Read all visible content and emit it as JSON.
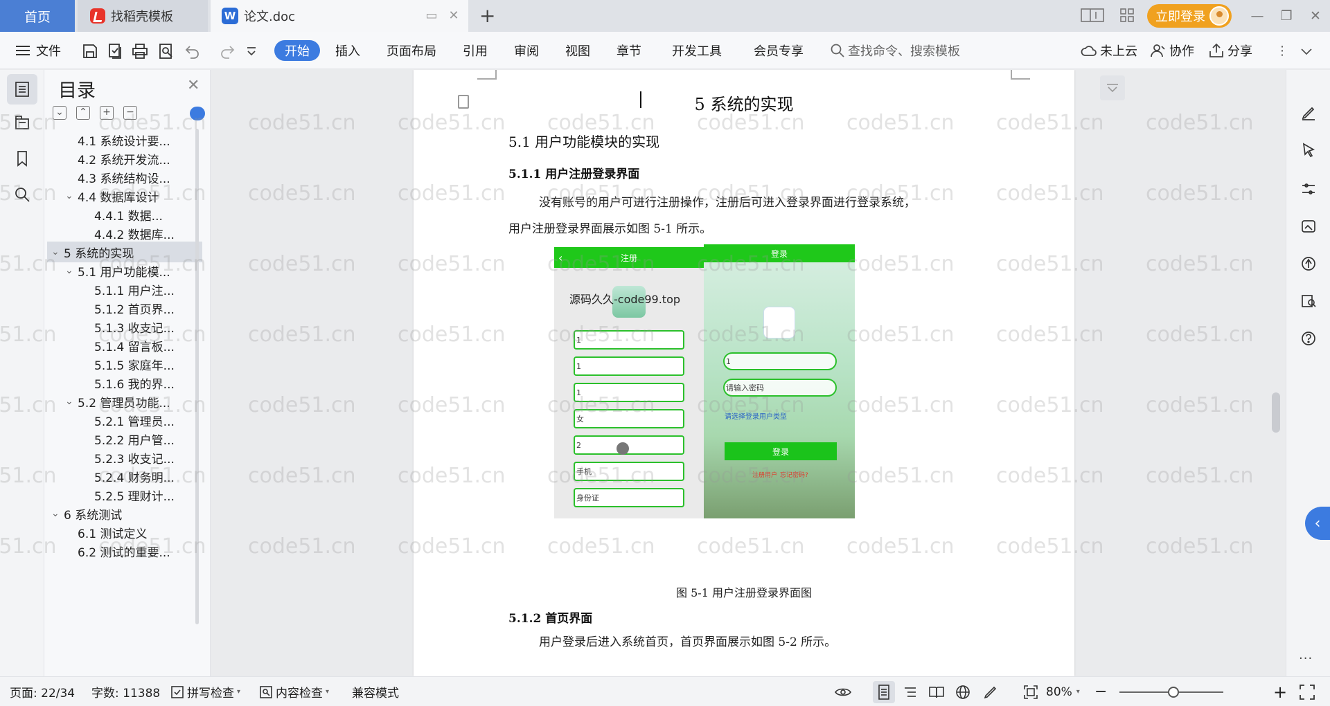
{
  "tabs": {
    "home": "首页",
    "template": "找稻壳模板",
    "document": "论文.doc"
  },
  "titlebar": {
    "login": "立即登录"
  },
  "menu": {
    "file": "文件",
    "items": [
      "开始",
      "插入",
      "页面布局",
      "引用",
      "审阅",
      "视图",
      "章节",
      "开发工具",
      "会员专享"
    ],
    "search_placeholder": "查找命令、搜索模板",
    "cloud": "未上云",
    "collab": "协作",
    "share": "分享"
  },
  "toc": {
    "title": "目录",
    "items": [
      {
        "label": "4.1 系统设计要...",
        "level": 2,
        "caret": ""
      },
      {
        "label": "4.2 系统开发流...",
        "level": 2,
        "caret": ""
      },
      {
        "label": "4.3 系统结构设...",
        "level": 2,
        "caret": ""
      },
      {
        "label": "4.4 数据库设计",
        "level": 2,
        "caret": "v"
      },
      {
        "label": "4.4.1 数据...",
        "level": 3,
        "caret": ""
      },
      {
        "label": "4.4.2 数据库...",
        "level": 3,
        "caret": ""
      },
      {
        "label": "5  系统的实现",
        "level": 1,
        "caret": "v",
        "selected": true
      },
      {
        "label": "5.1 用户功能模...",
        "level": 2,
        "caret": "v"
      },
      {
        "label": "5.1.1 用户注...",
        "level": 3,
        "caret": ""
      },
      {
        "label": "5.1.2 首页界...",
        "level": 3,
        "caret": ""
      },
      {
        "label": "5.1.3 收支记...",
        "level": 3,
        "caret": ""
      },
      {
        "label": "5.1.4 留言板...",
        "level": 3,
        "caret": ""
      },
      {
        "label": "5.1.5 家庭年...",
        "level": 3,
        "caret": ""
      },
      {
        "label": "5.1.6 我的界...",
        "level": 3,
        "caret": ""
      },
      {
        "label": "5.2 管理员功能...",
        "level": 2,
        "caret": "v"
      },
      {
        "label": "5.2.1 管理员...",
        "level": 3,
        "caret": ""
      },
      {
        "label": "5.2.2 用户管...",
        "level": 3,
        "caret": ""
      },
      {
        "label": "5.2.3 收支记...",
        "level": 3,
        "caret": ""
      },
      {
        "label": "5.2.4 财务明...",
        "level": 3,
        "caret": ""
      },
      {
        "label": "5.2.5 理财计...",
        "level": 3,
        "caret": ""
      },
      {
        "label": "6 系统测试",
        "level": 1,
        "caret": "v"
      },
      {
        "label": "6.1 测试定义",
        "level": 2,
        "caret": ""
      },
      {
        "label": "6.2 测试的重要...",
        "level": 2,
        "caret": ""
      }
    ]
  },
  "document": {
    "chapter_title": "5  系统的实现",
    "section_title": "5.1 用户功能模块的实现",
    "subsection_1": "5.1.1 用户注册登录界面",
    "para_1_line1": "没有账号的用户可进行注册操作，注册后可进入登录界面进行登录系统，",
    "para_1_line2": "用户注册登录界面展示如图 5-1 所示。",
    "figure_caption": "图 5-1    用户注册登录界面图",
    "subsection_2": "5.1.2 首页界面",
    "para_2": "用户登录后进入系统首页，首页界面展示如图 5-2 所示。",
    "figure": {
      "register_title": "注册",
      "register_fields": [
        "1",
        "1",
        "1",
        "女",
        "2",
        "手机",
        "身份证"
      ],
      "overlay_text": "源码久久-code99.top",
      "login_title": "登录",
      "login_fields": [
        "1",
        "请输入密码"
      ],
      "login_hint": "请选择登录用户类型",
      "login_button": "登录",
      "register_link": "注册用户",
      "forgot_link": "忘记密码?"
    }
  },
  "watermark_text": "code51.cn",
  "statusbar": {
    "page": "页面: 22/34",
    "words": "字数: 11388",
    "spell": "拼写检查",
    "content": "内容检查",
    "compat": "兼容模式",
    "zoom": "80%"
  },
  "colors": {
    "accent": "#3c7be0",
    "login": "#f0a11f",
    "phone_green": "#1fc81a"
  }
}
